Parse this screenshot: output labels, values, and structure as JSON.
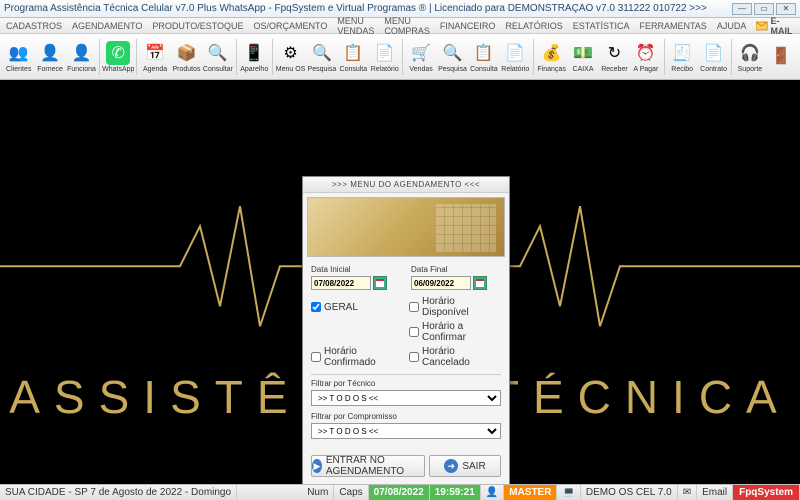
{
  "window": {
    "title": "Programa Assistência Técnica Celular v7.0 Plus WhatsApp - FpqSystem e Virtual Programas ® | Licenciado para  DEMONSTRAÇÃO v7.0 311222 010722 >>>"
  },
  "menu": {
    "items": [
      "CADASTROS",
      "AGENDAMENTO",
      "PRODUTO/ESTOQUE",
      "OS/ORÇAMENTO",
      "MENU VENDAS",
      "MENU COMPRAS",
      "FINANCEIRO",
      "RELATÓRIOS",
      "ESTATÍSTICA",
      "FERRAMENTAS",
      "AJUDA"
    ],
    "email": "E-MAIL"
  },
  "toolbar": {
    "buttons": [
      {
        "label": "Clientes",
        "icon": "👥",
        "name": "clientes-button"
      },
      {
        "label": "Fornece",
        "icon": "👤",
        "name": "fornece-button"
      },
      {
        "label": "Funciona",
        "icon": "👤",
        "name": "funciona-button"
      },
      {
        "label": "WhatsApp",
        "icon": "✆",
        "name": "whatsapp-button",
        "bg": "#25d366"
      },
      {
        "label": "Agenda",
        "icon": "📅",
        "name": "agenda-button"
      },
      {
        "label": "Produtos",
        "icon": "📦",
        "name": "produtos-button"
      },
      {
        "label": "Consultar",
        "icon": "🔍",
        "name": "consultar-produtos-button"
      },
      {
        "label": "Aparelho",
        "icon": "📱",
        "name": "aparelho-button"
      },
      {
        "label": "Menu OS",
        "icon": "⚙",
        "name": "menu-os-button"
      },
      {
        "label": "Pesquisa",
        "icon": "🔍",
        "name": "pesquisa-os-button"
      },
      {
        "label": "Consulta",
        "icon": "📋",
        "name": "consulta-os-button"
      },
      {
        "label": "Relatório",
        "icon": "📄",
        "name": "relatorio-os-button"
      },
      {
        "label": "Vendas",
        "icon": "🛒",
        "name": "vendas-button"
      },
      {
        "label": "Pesquisa",
        "icon": "🔍",
        "name": "pesquisa-vendas-button"
      },
      {
        "label": "Consulta",
        "icon": "📋",
        "name": "consulta-vendas-button"
      },
      {
        "label": "Relatório",
        "icon": "📄",
        "name": "relatorio-vendas-button"
      },
      {
        "label": "Finanças",
        "icon": "💰",
        "name": "financas-button"
      },
      {
        "label": "CAIXA",
        "icon": "💵",
        "name": "caixa-button"
      },
      {
        "label": "Receber",
        "icon": "↻",
        "name": "receber-button"
      },
      {
        "label": "A Pagar",
        "icon": "⏰",
        "name": "apagar-button"
      },
      {
        "label": "Recibo",
        "icon": "🧾",
        "name": "recibo-button"
      },
      {
        "label": "Contrato",
        "icon": "📄",
        "name": "contrato-button"
      },
      {
        "label": "Suporte",
        "icon": "🎧",
        "name": "suporte-button"
      },
      {
        "label": "",
        "icon": "🚪",
        "name": "sair-button"
      }
    ]
  },
  "background": {
    "text": "ASSISTÊNCIA TÉCNICA"
  },
  "dialog": {
    "title": ">>>  MENU DO AGENDAMENTO  <<<",
    "date_initial_label": "Data Inicial",
    "date_initial": "07/08/2022",
    "date_final_label": "Data Final",
    "date_final": "06/09/2022",
    "checks": {
      "geral": "GERAL",
      "disponivel": "Horário  Disponível",
      "confirmar": "Horário a Confirmar",
      "confirmado": "Horário Confirmado",
      "cancelado": "Horário Cancelado"
    },
    "filter_tecnico_label": "Filtrar por Técnico",
    "filter_tecnico_value": ">> T O D O S <<",
    "filter_compromisso_label": "Filtrar por Compromisso",
    "filter_compromisso_value": ">> T O D O S <<",
    "btn_enter": "ENTRAR NO AGENDAMENTO",
    "btn_exit": "SAIR"
  },
  "status": {
    "location": "SUA CIDADE - SP  7 de Agosto de 2022  -  Domingo",
    "num": "Num",
    "caps": "Caps",
    "date": "07/08/2022",
    "time": "19:59:21",
    "master": "MASTER",
    "demo": "DEMO OS CEL 7.0",
    "email": "Email",
    "brand": "FpqSystem"
  }
}
